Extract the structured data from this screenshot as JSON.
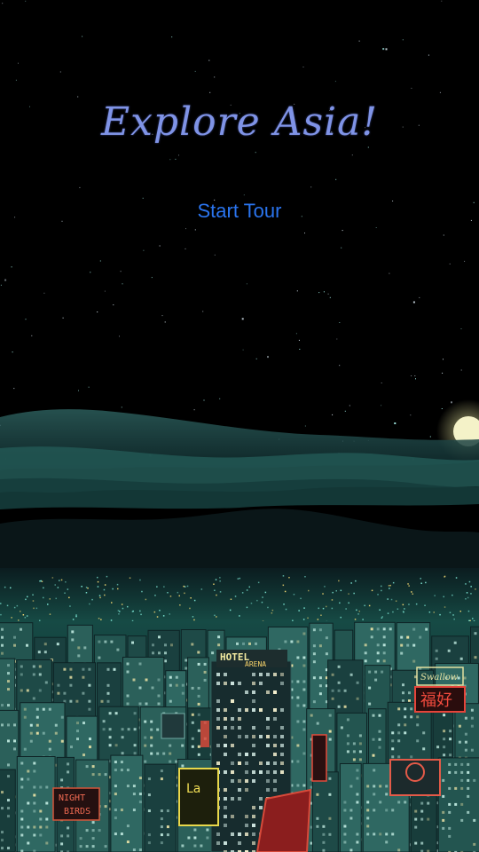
{
  "app": {
    "title": "Explore Asia!",
    "start_label": "Start Tour"
  },
  "signs": {
    "hotel": "HOTEL",
    "hotel_sub": "ARENA",
    "night_birds_1": "NIGHT",
    "night_birds_2": "BIRDS",
    "la": "La",
    "fuhao": "福好",
    "swallow": "Swallow"
  },
  "colors": {
    "title": "#7f93e6",
    "start_button": "#2a74ee",
    "sky": "#000000",
    "city_glow": "#1b6e62",
    "moon": "#f4f2c8"
  }
}
